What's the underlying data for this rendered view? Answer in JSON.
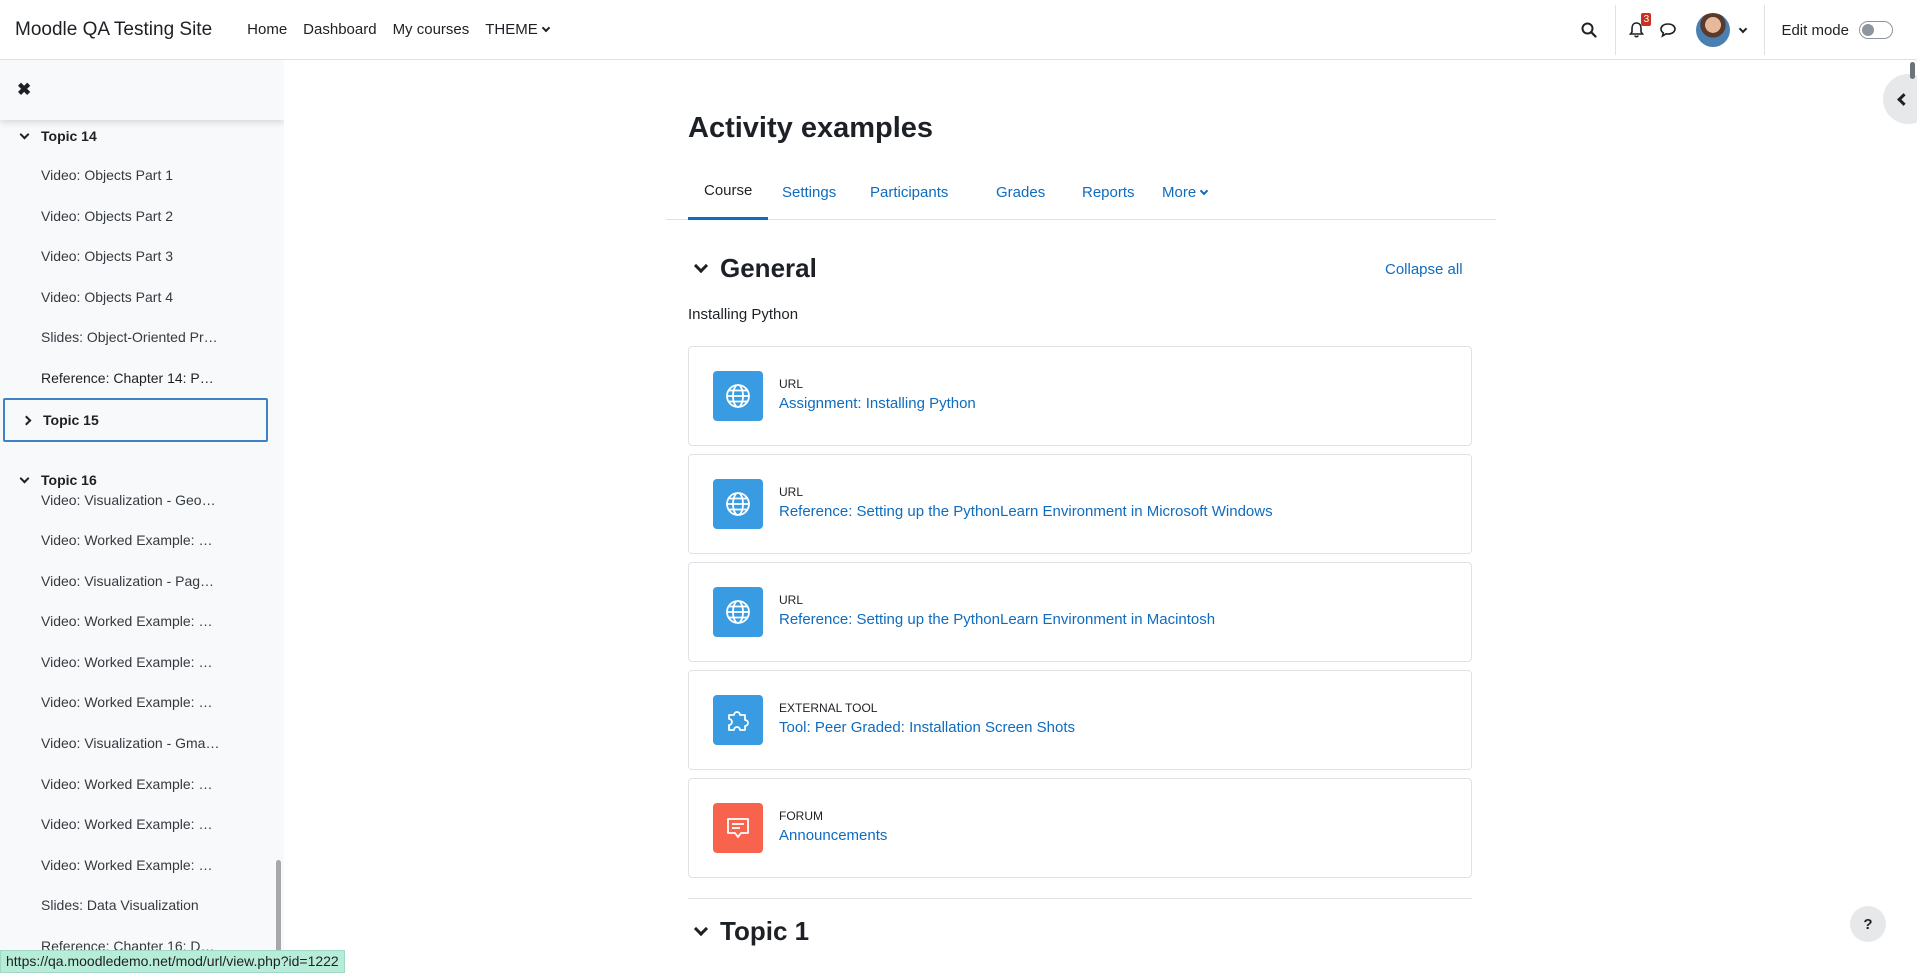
{
  "navbar": {
    "brand": "Moodle QA Testing Site",
    "links": [
      "Home",
      "Dashboard",
      "My courses"
    ],
    "theme_label": "THEME",
    "notification_count": "3",
    "edit_mode_label": "Edit mode"
  },
  "course_index": {
    "items": [
      {
        "kind": "topic",
        "label": "Topic 14",
        "expanded": true
      },
      {
        "kind": "item",
        "label": "Video: Objects Part 1"
      },
      {
        "kind": "item",
        "label": "Video: Objects Part 2"
      },
      {
        "kind": "item",
        "label": "Video: Objects Part 3"
      },
      {
        "kind": "item",
        "label": "Video: Objects Part 4"
      },
      {
        "kind": "item",
        "label": "Slides: Object-Oriented Pr…"
      },
      {
        "kind": "item",
        "label": "Reference: Chapter 14: P…"
      },
      {
        "kind": "topic",
        "label": "Topic 15",
        "expanded": false
      },
      {
        "kind": "topic",
        "label": "Topic 16",
        "expanded": true
      },
      {
        "kind": "item",
        "label": "Video: Visualization - Geo…"
      },
      {
        "kind": "item",
        "label": "Video: Worked Example: …"
      },
      {
        "kind": "item",
        "label": "Video: Visualization - Pag…"
      },
      {
        "kind": "item",
        "label": "Video: Worked Example: …"
      },
      {
        "kind": "item",
        "label": "Video: Worked Example: …"
      },
      {
        "kind": "item",
        "label": "Video: Worked Example: …"
      },
      {
        "kind": "item",
        "label": "Video: Visualization - Gma…"
      },
      {
        "kind": "item",
        "label": "Video: Worked Example: …"
      },
      {
        "kind": "item",
        "label": "Video: Worked Example: …"
      },
      {
        "kind": "item",
        "label": "Video: Worked Example: …"
      },
      {
        "kind": "item",
        "label": "Slides: Data Visualization"
      },
      {
        "kind": "item",
        "label": "Reference: Chapter 16: D…"
      }
    ]
  },
  "page": {
    "title": "Activity examples",
    "tabs": [
      "Course",
      "Settings",
      "Participants",
      "Grades",
      "Reports",
      "More"
    ],
    "collapse_all": "Collapse all"
  },
  "sections": [
    {
      "title": "General",
      "summary": "Installing Python",
      "activities": [
        {
          "type": "URL",
          "name": "Assignment: Installing Python",
          "icon": "globe-icon"
        },
        {
          "type": "URL",
          "name": "Reference: Setting up the PythonLearn Environment in Microsoft Windows",
          "icon": "globe-icon"
        },
        {
          "type": "URL",
          "name": "Reference: Setting up the PythonLearn Environment in Macintosh",
          "icon": "globe-icon"
        },
        {
          "type": "External tool",
          "name": "Tool: Peer Graded: Installation Screen Shots",
          "icon": "puzzle-icon"
        },
        {
          "type": "Forum",
          "name": "Announcements",
          "icon": "forum-icon"
        }
      ]
    },
    {
      "title": "Topic 1"
    }
  ],
  "help_label": "?",
  "status_url": "https://qa.moodledemo.net/mod/url/view.php?id=1222",
  "colors": {
    "link": "#0f6cbf",
    "url_icon_bg": "#399be2",
    "forum_icon_bg": "#f7634d",
    "focus": "#3e83c3"
  }
}
